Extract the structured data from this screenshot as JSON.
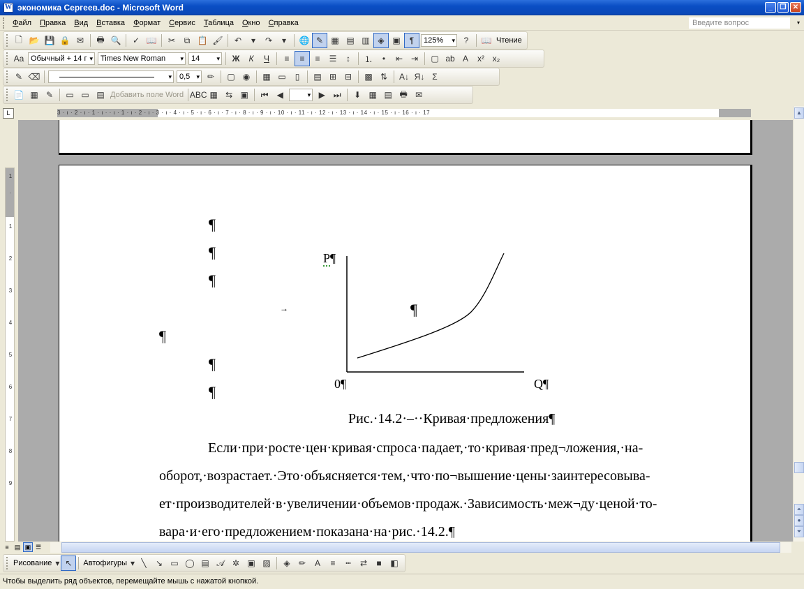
{
  "window": {
    "title": "экономика Сергеев.doc - Microsoft Word",
    "minimize": "_",
    "maximize": "❐",
    "close": "✕"
  },
  "menu": {
    "items": [
      "Файл",
      "Правка",
      "Вид",
      "Вставка",
      "Формат",
      "Сервис",
      "Таблица",
      "Окно",
      "Справка"
    ],
    "help_placeholder": "Введите вопрос"
  },
  "standard_toolbar": {
    "zoom": "125%",
    "reading_label": "Чтение"
  },
  "format_toolbar": {
    "style": "Обычный + 14 г",
    "font": "Times New Roman",
    "size": "14",
    "bold": "Ж",
    "italic": "К",
    "underline": "Ч"
  },
  "tables_toolbar": {
    "line_weight": "0,5"
  },
  "mail_merge_toolbar": {
    "add_field": "Добавить поле Word"
  },
  "ruler": {
    "corner": "L",
    "h_marks": "3 · ı · 2 · ı · 1 · ı ·   · ı · 1 · ı · 2 · ı · 3 · ı · 4 · ı · 5 · ı · 6 · ı · 7 · ı · 8 · ı · 9 · ı · 10 · ı · 11 · ı · 12 · ı · 13 · ı · 14 · ı · 15 · ı · 16 · ı · 17",
    "v_marks": [
      "1",
      "·",
      "1",
      "2",
      "3",
      "4",
      "5",
      "6",
      "7",
      "8",
      "9"
    ]
  },
  "document": {
    "para": "¶",
    "tab": "→",
    "chart": {
      "p_label": "P",
      "zero_label": "0",
      "q_label": "Q"
    },
    "caption": "Рис.·14.2·–··Кривая·предложения¶",
    "body_lines": [
      "Если·при·росте·цен·кривая·спроса·падает,·то·кривая·пред¬ложения,·на-",
      "оборот,·возрастает.·Это·объясняется·тем,·что·по¬вышение·цены·заинтересовыва-",
      "ет·производителей·в·увеличении·объемов·продаж.·Зависимость·меж¬ду·ценой·то-",
      "вара·и·его·предложением·показана·на·рис.·14.2.¶"
    ]
  },
  "drawing_toolbar": {
    "draw_label": "Рисование",
    "autoshapes_label": "Автофигуры"
  },
  "status": {
    "text": "Чтобы выделить ряд объектов, перемещайте мышь с нажатой кнопкой."
  }
}
